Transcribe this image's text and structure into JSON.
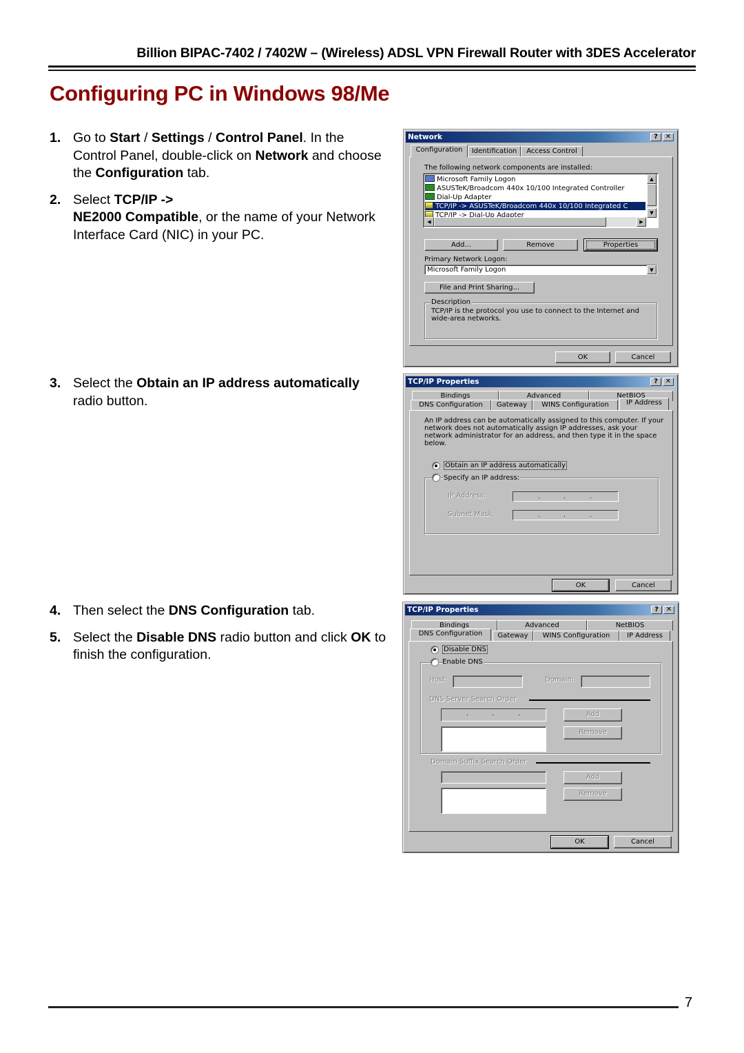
{
  "header": {
    "running_title": "Billion BIPAC-7402 / 7402W – (Wireless) ADSL VPN Firewall Router with 3DES Accelerator"
  },
  "page_title": "Configuring PC in Windows 98/Me",
  "steps": [
    {
      "num": "1.",
      "parts": [
        {
          "t": "Go to ",
          "b": false
        },
        {
          "t": "Start",
          "b": true
        },
        {
          "t": " / ",
          "b": false
        },
        {
          "t": "Settings",
          "b": true
        },
        {
          "t": " / ",
          "b": false
        },
        {
          "t": "Control Panel",
          "b": true
        },
        {
          "t": ". In the Control Panel, double-click on ",
          "b": false
        },
        {
          "t": "Network",
          "b": true
        },
        {
          "t": " and choose the ",
          "b": false
        },
        {
          "t": "Configuration",
          "b": true
        },
        {
          "t": " tab.",
          "b": false
        }
      ]
    },
    {
      "num": "2.",
      "parts": [
        {
          "t": "Select ",
          "b": false
        },
        {
          "t": "TCP/IP ->",
          "b": true
        },
        {
          "t": "\n",
          "b": false
        },
        {
          "t": "NE2000 Compatible",
          "b": true
        },
        {
          "t": ", or the name of your Network Interface Card (NIC) in your PC.",
          "b": false
        }
      ]
    },
    {
      "num": "3.",
      "parts": [
        {
          "t": "Select the ",
          "b": false
        },
        {
          "t": "Obtain an IP address automatically",
          "b": true
        },
        {
          "t": " radio button.",
          "b": false
        }
      ]
    },
    {
      "num": "4.",
      "parts": [
        {
          "t": "Then select the ",
          "b": false
        },
        {
          "t": "DNS Configuration",
          "b": true
        },
        {
          "t": " tab.",
          "b": false
        }
      ]
    },
    {
      "num": "5.",
      "parts": [
        {
          "t": "Select the ",
          "b": false
        },
        {
          "t": "Disable DNS",
          "b": true
        },
        {
          "t": " radio button and click ",
          "b": false
        },
        {
          "t": "OK",
          "b": true
        },
        {
          "t": " to finish the configuration.",
          "b": false
        }
      ]
    }
  ],
  "network_dialog": {
    "title": "Network",
    "help_btn": "?",
    "close_btn": "✕",
    "tabs": [
      "Configuration",
      "Identification",
      "Access Control"
    ],
    "active_tab": "Configuration",
    "components_label": "The following network components are installed:",
    "components": [
      {
        "icon": "pc",
        "label": "Microsoft Family Logon",
        "selected": false
      },
      {
        "icon": "card",
        "label": "ASUSTeK/Broadcom 440x 10/100 Integrated Controller",
        "selected": false
      },
      {
        "icon": "card",
        "label": "Dial-Up Adapter",
        "selected": false
      },
      {
        "icon": "proto",
        "label": "TCP/IP -> ASUSTeK/Broadcom 440x 10/100 Integrated C",
        "selected": true
      },
      {
        "icon": "proto",
        "label": "TCP/IP -> Dial-Up Adapter",
        "selected": false
      }
    ],
    "add_btn": "Add...",
    "remove_btn": "Remove",
    "properties_btn": "Properties",
    "primary_logon_label": "Primary Network Logon:",
    "primary_logon_value": "Microsoft Family Logon",
    "file_print_btn": "File and Print Sharing...",
    "description_legend": "Description",
    "description_text": "TCP/IP is the protocol you use to connect to the Internet and wide-area networks.",
    "ok_btn": "OK",
    "cancel_btn": "Cancel"
  },
  "tcpip_ip_dialog": {
    "title": "TCP/IP Properties",
    "help_btn": "?",
    "close_btn": "✕",
    "tabs_row1": [
      "Bindings",
      "Advanced",
      "NetBIOS"
    ],
    "tabs_row2": [
      "DNS Configuration",
      "Gateway",
      "WINS Configuration",
      "IP Address"
    ],
    "active_tab": "IP Address",
    "intro_text": "An IP address can be automatically assigned to this computer. If your network does not automatically assign IP addresses, ask your network administrator for an address, and then type it in the space below.",
    "radio_obtain": "Obtain an IP address automatically",
    "radio_specify": "Specify an IP address:",
    "selected_radio": "obtain",
    "ip_address_label": "IP Address:",
    "subnet_mask_label": "Subnet Mask:",
    "ip_dot": ".",
    "ok_btn": "OK",
    "cancel_btn": "Cancel"
  },
  "tcpip_dns_dialog": {
    "title": "TCP/IP Properties",
    "help_btn": "?",
    "close_btn": "✕",
    "tabs_row1": [
      "Bindings",
      "Advanced",
      "NetBIOS"
    ],
    "tabs_row2": [
      "DNS Configuration",
      "Gateway",
      "WINS Configuration",
      "IP Address"
    ],
    "active_tab": "DNS Configuration",
    "radio_disable": "Disable DNS",
    "radio_enable": "Enable DNS",
    "selected_radio": "disable",
    "host_label": "Host:",
    "domain_label": "Domain:",
    "dns_server_order_label": "DNS Server Search Order",
    "domain_suffix_order_label": "Domain Suffix Search Order",
    "add_btn": "Add",
    "remove_btn": "Remove",
    "ip_dot": ".",
    "ok_btn": "OK",
    "cancel_btn": "Cancel"
  },
  "footer": {
    "page_number": "7"
  }
}
